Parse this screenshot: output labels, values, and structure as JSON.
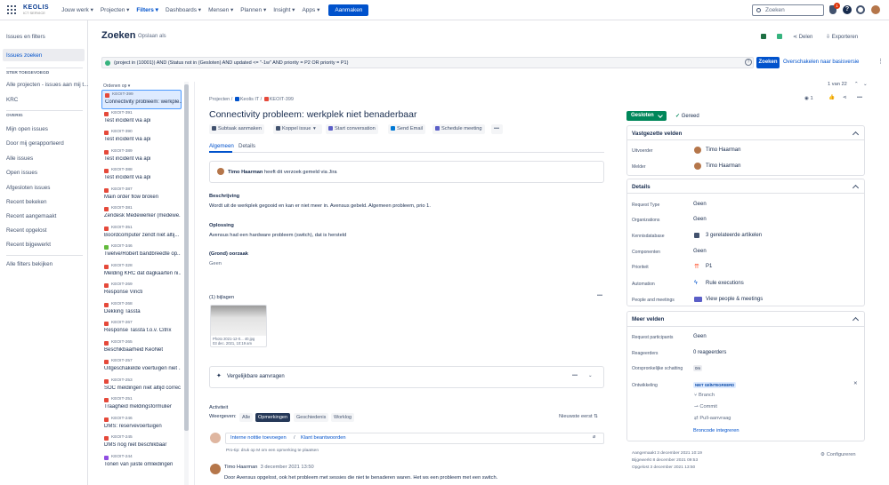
{
  "topbar": {
    "logo_text": "KEOLIS",
    "logo_sub": "ICT SERVICE",
    "nav": [
      {
        "label": "Jouw werk ▾"
      },
      {
        "label": "Projecten ▾"
      },
      {
        "label": "Filters ▾"
      },
      {
        "label": "Dashboards ▾"
      },
      {
        "label": "Mensen ▾"
      },
      {
        "label": "Plannen ▾"
      },
      {
        "label": "Insight ▾"
      },
      {
        "label": "Apps ▾"
      }
    ],
    "create_label": "Aanmaken",
    "search_placeholder": "Zoeken",
    "notification_count": "1"
  },
  "sidebar": {
    "title": "Issues en filters",
    "selected": "Issues zoeken",
    "starred_header": "STER TOEGEVOEGD",
    "starred": [
      "Alle projecten - issues aan mij t...",
      "KRC"
    ],
    "overview_header": "OVERIG",
    "items": [
      "Mijn open issues",
      "Door mij gerapporteerd",
      "Alle issues",
      "Open issues",
      "Afgesloten issues",
      "Recent bekeken",
      "Recent aangemaakt",
      "Recent opgelost",
      "Recent bijgewerkt"
    ],
    "all_filters": "Alle filters bekijken"
  },
  "header": {
    "title": "Zoeken",
    "save_as": "Opslaan als",
    "share": "Delen",
    "export": "Exporteren"
  },
  "jql": {
    "query": "(project in (10001)) AND (Status not in (Gesloten) AND updated <= \"-1w\" AND priority = P2 OR priority = P1)",
    "search_button": "Zoeken",
    "basic_link": "Overschakelen naar basisversie"
  },
  "list": {
    "order_by": "Ordenen op ▾",
    "items": [
      {
        "key": "KEOIT-399",
        "summary": "Connectivity probleem: werkple...",
        "color": "#e5493a"
      },
      {
        "key": "KEOIT-391",
        "summary": "Test incident via api",
        "color": "#e5493a"
      },
      {
        "key": "KEOIT-390",
        "summary": "Test incident via api",
        "color": "#e5493a"
      },
      {
        "key": "KEOIT-389",
        "summary": "Test incident via api",
        "color": "#e5493a"
      },
      {
        "key": "KEOIT-388",
        "summary": "Test incident via api",
        "color": "#e5493a"
      },
      {
        "key": "KEOIT-387",
        "summary": "Main order flow broken",
        "color": "#e5493a"
      },
      {
        "key": "KEOIT-381",
        "summary": "Zendesk Medewerker (medewe...",
        "color": "#e5493a"
      },
      {
        "key": "KEOIT-351",
        "summary": "Boordcomputer zendt niet altij...",
        "color": "#e5493a"
      },
      {
        "key": "KEOIT-346",
        "summary": "Twelve/Robert bandbreedte op...",
        "color": "#63ba3c"
      },
      {
        "key": "KEOIT-328",
        "summary": "Melding KRC dat dagkaarten ni...",
        "color": "#e5493a"
      },
      {
        "key": "KEOIT-269",
        "summary": "Response Viricti",
        "color": "#e5493a"
      },
      {
        "key": "KEOIT-268",
        "summary": "Dekking Tassta",
        "color": "#e5493a"
      },
      {
        "key": "KEOIT-267",
        "summary": "Response Tassta t.o.v. Citrix",
        "color": "#e5493a"
      },
      {
        "key": "KEOIT-265",
        "summary": "Beschikbaarheid KeoNet",
        "color": "#e5493a"
      },
      {
        "key": "KEOIT-257",
        "summary": "Uitgeschakelde voertuigen niet ...",
        "color": "#e5493a"
      },
      {
        "key": "KEOIT-253",
        "summary": "SOC meldingen niet altijd correct",
        "color": "#e5493a"
      },
      {
        "key": "KEOIT-251",
        "summary": "Traagheid meldingsformulier",
        "color": "#e5493a"
      },
      {
        "key": "KEOIT-246",
        "summary": "DMS: reservevoertuigen",
        "color": "#e5493a"
      },
      {
        "key": "KEOIT-245",
        "summary": "DMS nog niet beschikbaar",
        "color": "#e5493a"
      },
      {
        "key": "KEOIT-244",
        "summary": "Tonen van juiste omleidingen",
        "color": "#904ee2"
      }
    ]
  },
  "issue": {
    "crumb_projects": "Projecten",
    "crumb_project": "Keolis IT",
    "crumb_key": "KEOIT-399",
    "title": "Connectivity probleem: werkplek niet benaderbaar",
    "actions": [
      "Subtaak aanmaken",
      "Koppel issue",
      "Start conversation",
      "Send Email",
      "Schedule meeting"
    ],
    "tabs": [
      "Algemeen",
      "Details"
    ],
    "created_by_name": "Timo Haarman",
    "created_by_text": "heeft dit verzoek gemeld via Jira",
    "desc_label": "Beschrijving",
    "desc": "Wordt uit de werkplek gegooid en kan er niet meer in. Avensus gebeld. Algemeen probleem, prio 1.",
    "solution_label": "Oplossing",
    "solution": "Avensus had een hardware probleem (switch), dat is hersteld",
    "cause_label": "(Grond) oorzaak",
    "cause": "Geen",
    "attachments_label": "(1) bijlagen",
    "att_name": "Photo 2021-12-0... 40.jpg",
    "att_date": "03 dec. 2021, 10:19 am",
    "similar_label": "Vergelijkbare aanvragen",
    "activity_label": "Activiteit",
    "show_label": "Weergeven:",
    "filters": [
      "Alle",
      "Opmerkingen",
      "Geschiedenis",
      "Worklog"
    ],
    "sort": "Nieuwste eerst ⇅",
    "internal_note": "Interne notitie toevoegen",
    "reply": "Klant beantwoorden",
    "protip": "Pro-tip: druk op M om een opmerking te plaatsen",
    "comment_author": "Timo Haarman",
    "comment_date": "3 december 2021 13:50",
    "comment_text": "Door Avensus opgelost, ook het probleem met sessies die niet te benaderen waren. Het ws een probleem met een switch."
  },
  "right": {
    "pager": "1 van 22",
    "watchers": "1",
    "status": "Gesloten",
    "resolution": "Gereed",
    "pinned_header": "Vastgezette velden",
    "assignee_label": "Uitvoerder",
    "assignee": "Timo Haarman",
    "reporter_label": "Melder",
    "reporter": "Timo Haarman",
    "details_header": "Details",
    "fields": [
      {
        "label": "Request Type",
        "value": "Geen"
      },
      {
        "label": "Organizations",
        "value": "Geen"
      },
      {
        "label": "Kennisdatabase",
        "value": "3 gerelateerde artikelen"
      },
      {
        "label": "Componenten",
        "value": "Geen"
      },
      {
        "label": "Prioriteit",
        "value": "P1"
      },
      {
        "label": "Automation",
        "value": "Rule executions"
      },
      {
        "label": "People and meetings",
        "value": "View people & meetings"
      }
    ],
    "more_header": "Meer velden",
    "more_fields": [
      {
        "label": "Request participants",
        "value": "Geen"
      },
      {
        "label": "Reageerders",
        "value": "0 reageerders"
      },
      {
        "label": "Oorspronkelijke schatting",
        "value": "0m"
      },
      {
        "label": "Ontwikkeling",
        "value": "NIET GEÏNTEGREERD"
      }
    ],
    "dev_items": [
      "Branch",
      "Commit",
      "Pull-aanvraag"
    ],
    "dev_link": "Broncode integreren",
    "created": "Aangemaakt 3 december 2021 10:19",
    "updated": "Bijgewerkt 8 december 2021 09:53",
    "resolved": "Opgelost 3 december 2021 13:50",
    "configure": "Configureren"
  }
}
